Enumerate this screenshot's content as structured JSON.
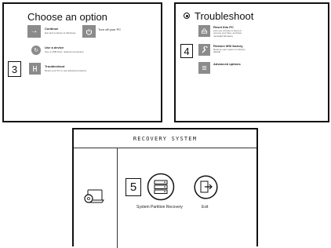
{
  "choose_screen": {
    "title": "Choose an option",
    "options": [
      {
        "icon": "arrow-right-icon",
        "title": "Continue",
        "desc": "Exit and continue to Windows"
      },
      {
        "icon": "power-icon",
        "title": "Turn off your PC",
        "desc": ""
      },
      {
        "icon": "refresh-icon",
        "title": "Use a device",
        "desc": "Use a USB drive, network connection"
      },
      {
        "icon": "tools-icon",
        "title": "Troubleshoot",
        "desc": "Reset your PC or see advanced options"
      }
    ],
    "step_number": "3"
  },
  "troubleshoot_screen": {
    "title": "Troubleshoot",
    "options": [
      {
        "icon": "reset-pc-icon",
        "title": "Reset this PC",
        "desc": "Lets you choose to keep or remove your files, and then reinstalls Windows"
      },
      {
        "icon": "wrench-icon",
        "title": "Restore MSI factory",
        "desc": "Restore your system to factory default"
      },
      {
        "icon": "checklist-icon",
        "title": "Advanced options",
        "desc": ""
      }
    ],
    "step_number": "4"
  },
  "recovery_screen": {
    "title": "RECOVERY SYSTEM",
    "step_number": "5",
    "items": [
      {
        "icon": "drives-icon",
        "label": "System Partition Recovery"
      },
      {
        "icon": "exit-icon",
        "label": "Exit"
      }
    ],
    "side_icon": "laptop-disc-icon"
  },
  "colors": {
    "tile": "#8b8b8b",
    "border": "#111111"
  }
}
